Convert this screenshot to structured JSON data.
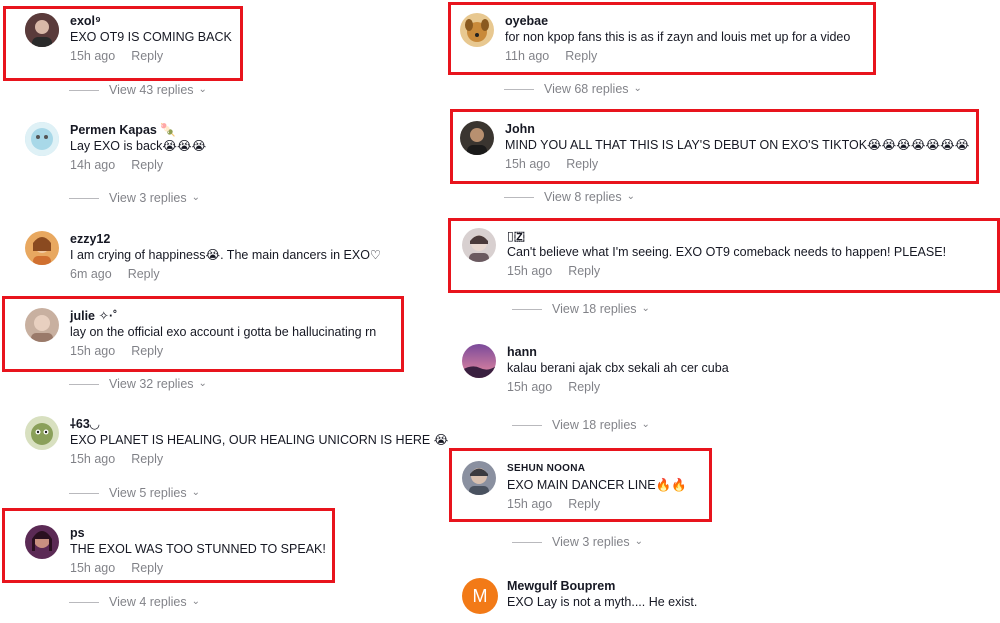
{
  "colors": {
    "highlight": "#e8141d",
    "text": "#161823",
    "muted": "#8a8b91",
    "avatar_m": "#f27a17"
  },
  "left": {
    "comments": [
      {
        "avatar": "person-avatar",
        "avatar_color": "#5a3b3b",
        "name": "exol⁹",
        "text": "EXO OT9 IS COMING BACK",
        "time": "15h ago",
        "reply": "Reply"
      },
      {
        "avatar": "cartoon-avatar",
        "avatar_color": "#a8d8e8",
        "name": "Permen Kapas 🍡",
        "text": "Lay EXO is back😭😭😭",
        "time": "14h ago",
        "reply": "Reply"
      },
      {
        "avatar": "person-avatar",
        "avatar_color": "#c9762f",
        "name": "ezzy12",
        "text": "I am crying of happiness😭. The main dancers in EXO♡",
        "time": "6m ago",
        "reply": "Reply"
      },
      {
        "avatar": "person-avatar",
        "avatar_color": "#b08a7a",
        "name": "julie ✧·˚",
        "text": "lay on the official exo account i gotta be hallucinating rn",
        "time": "15h ago",
        "reply": "Reply"
      },
      {
        "avatar": "creature-avatar",
        "avatar_color": "#8aa05a",
        "name": "⸸63◡",
        "text": "EXO PLANET IS HEALING, OUR HEALING UNICORN IS HERE 😭",
        "time": "15h ago",
        "reply": "Reply"
      },
      {
        "avatar": "person-avatar",
        "avatar_color": "#5b2a55",
        "name": "ps",
        "text": "THE EXOL WAS TOO STUNNED TO SPEAK!",
        "time": "15h ago",
        "reply": "Reply"
      }
    ],
    "view_replies": [
      "View 43 replies",
      "View 3 replies",
      "View 32 replies",
      "View 5 replies",
      "View 4 replies"
    ]
  },
  "right": {
    "comments": [
      {
        "avatar": "dog-avatar",
        "avatar_color": "#c98a3a",
        "name": "oyebae",
        "text": "for non kpop fans this is as if zayn and louis met up for a video",
        "time": "11h ago",
        "reply": "Reply"
      },
      {
        "avatar": "person-avatar",
        "avatar_color": "#3a3530",
        "name": "John",
        "text": "MIND YOU ALL THAT THIS IS LAY'S DEBUT ON EXO'S TIKTOK😭😭😭😭😭😭😭",
        "time": "15h ago",
        "reply": "Reply"
      },
      {
        "avatar": "person-avatar",
        "avatar_color": "#6a5a60",
        "name": "▯🇿",
        "text": "Can't believe what I'm seeing. EXO OT9 comeback needs to happen! PLEASE!",
        "time": "15h ago",
        "reply": "Reply"
      },
      {
        "avatar": "sunset-avatar",
        "avatar_color": "#c86a8a",
        "name": "hann",
        "text": "kalau berani ajak cbx sekali ah cer cuba",
        "time": "15h ago",
        "reply": "Reply"
      },
      {
        "avatar": "person-avatar",
        "avatar_color": "#4a5260",
        "name": "SEHUN NOONA",
        "text": "EXO MAIN DANCER LINE🔥🔥",
        "time": "15h ago",
        "reply": "Reply"
      },
      {
        "avatar": "letter-avatar",
        "avatar_color": "#f27a17",
        "avatar_letter": "M",
        "name": "Mewgulf Bouprem",
        "text": "EXO Lay is not a myth.... He exist.",
        "time": "",
        "reply": ""
      }
    ],
    "view_replies": [
      "View 68 replies",
      "View 8 replies",
      "View 18 replies",
      "View 18 replies",
      "View 3 replies"
    ]
  }
}
